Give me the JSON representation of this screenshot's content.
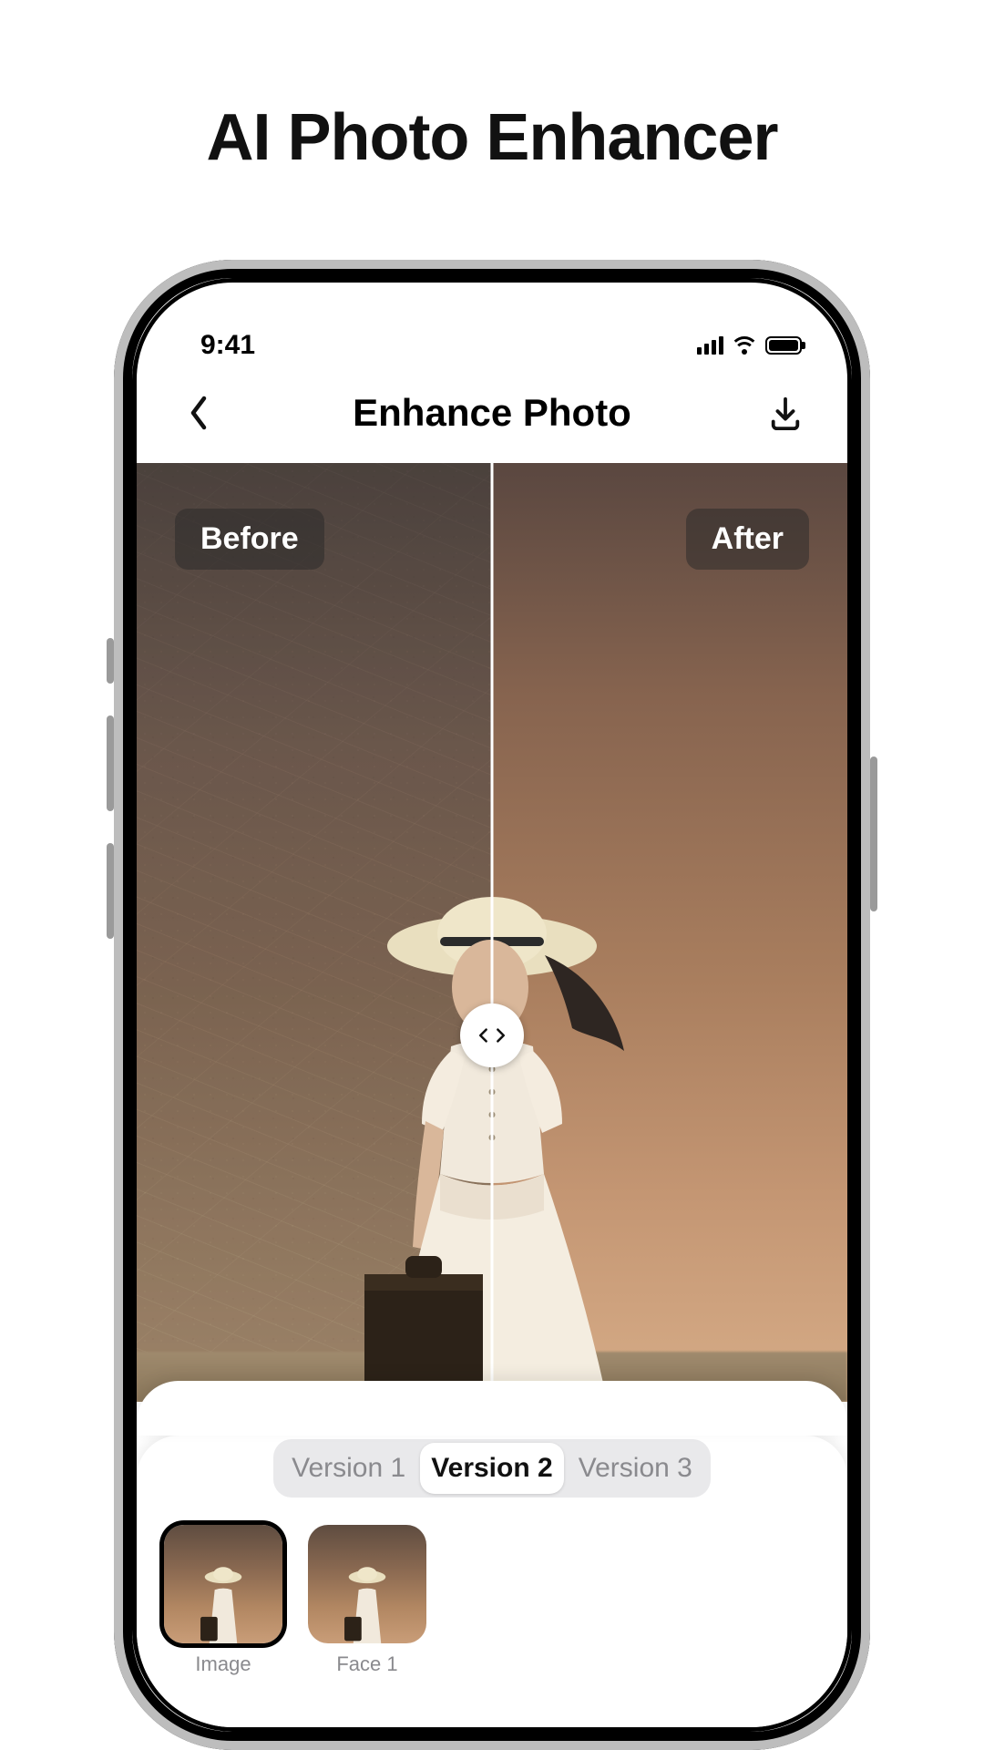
{
  "marketing": {
    "title": "AI Photo Enhancer"
  },
  "status_bar": {
    "time": "9:41"
  },
  "nav": {
    "back_icon": "chevron-left",
    "title": "Enhance Photo",
    "action_icon": "download"
  },
  "compare": {
    "before_label": "Before",
    "after_label": "After",
    "slider_position_pct": 50
  },
  "versions": {
    "items": [
      {
        "label": "Version 1",
        "active": false
      },
      {
        "label": "Version 2",
        "active": true
      },
      {
        "label": "Version 3",
        "active": false
      }
    ]
  },
  "thumbnails": [
    {
      "label": "Image",
      "active": true
    },
    {
      "label": "Face 1",
      "active": false
    }
  ]
}
